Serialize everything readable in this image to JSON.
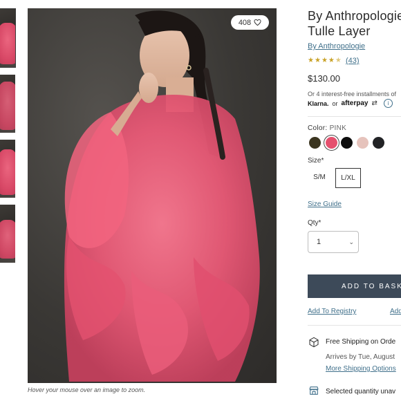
{
  "gallery": {
    "thumbnails": [
      "thumb-1",
      "thumb-2",
      "thumb-3",
      "thumb-4"
    ],
    "like_count": "408",
    "zoom_note": "Hover your mouse over an image to zoom."
  },
  "product": {
    "title_line1": "By Anthropologie",
    "title_line2": "Tulle Layer",
    "brand_link": "By Anthropologie",
    "rating_stars": 4.5,
    "review_count": "(43)",
    "price": "$130.00",
    "installments_text": "Or 4 interest-free installments of",
    "klarna": "Klarna.",
    "or": "or",
    "afterpay": "afterpay",
    "info_icon": "i"
  },
  "color": {
    "label": "Color:",
    "value": "PINK",
    "swatches": [
      {
        "name": "olive",
        "hex": "#3b3520"
      },
      {
        "name": "pink",
        "hex": "#e5506e",
        "selected": true
      },
      {
        "name": "black",
        "hex": "#0d0d0d"
      },
      {
        "name": "blush",
        "hex": "#e6c3bc"
      },
      {
        "name": "charcoal",
        "hex": "#222326"
      }
    ]
  },
  "size": {
    "label": "Size*",
    "options": [
      "S/M",
      "L/XL"
    ],
    "selected": "L/XL",
    "guide": "Size Guide"
  },
  "quantity": {
    "label": "Qty*",
    "value": "1"
  },
  "actions": {
    "add_to_bag": "ADD TO BASK",
    "add_to_registry": "Add To Registry",
    "secondary_link": "Add"
  },
  "shipping": {
    "title": "Free Shipping on Orde",
    "arrives": "Arrives by Tue, August",
    "options": "More Shipping Options"
  },
  "store": {
    "title": "Selected quantity unav"
  },
  "colors": {
    "link": "#3f6f8a",
    "button": "#3d4a59",
    "accent_pink": "#e5506e"
  }
}
